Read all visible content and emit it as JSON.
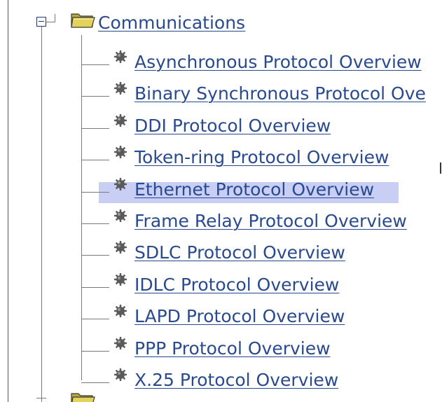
{
  "tree": {
    "root": {
      "label": "Communications",
      "icon": "folder-icon",
      "expanded": true
    },
    "items": [
      {
        "label": "Asynchronous Protocol Overview",
        "selected": false
      },
      {
        "label": "Binary Synchronous Protocol Ove",
        "selected": false
      },
      {
        "label": "DDI Protocol Overview",
        "selected": false
      },
      {
        "label": "Token-ring Protocol Overview",
        "selected": false
      },
      {
        "label": "Ethernet Protocol Overview",
        "selected": true
      },
      {
        "label": "Frame Relay Protocol Overview",
        "selected": false
      },
      {
        "label": "SDLC Protocol Overview",
        "selected": false
      },
      {
        "label": "IDLC Protocol Overview",
        "selected": false
      },
      {
        "label": "LAPD Protocol Overview",
        "selected": false
      },
      {
        "label": "PPP Protocol Overview",
        "selected": false
      },
      {
        "label": "X.25 Protocol Overview",
        "selected": false
      }
    ]
  },
  "colors": {
    "link": "#2a4a8f",
    "highlight": "#c8cef4",
    "tree_line": "#7a7a7a",
    "folder_fill": "#e3d35a"
  }
}
